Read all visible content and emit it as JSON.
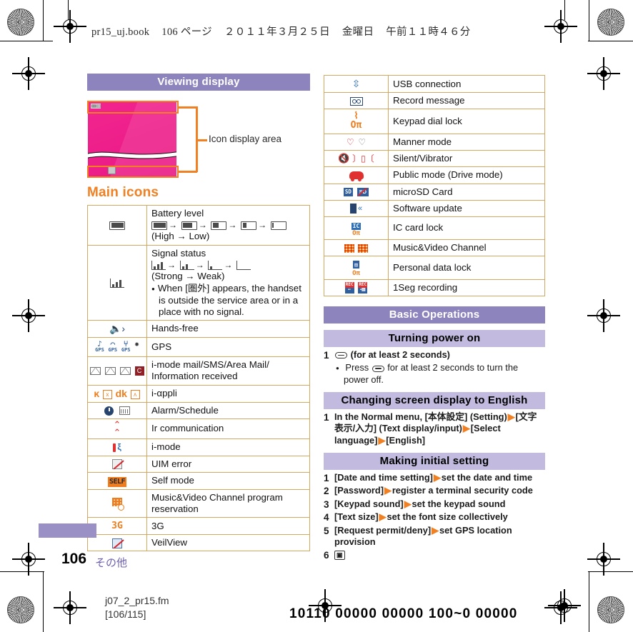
{
  "print_header": {
    "filename": "pr15_uj.book",
    "page": "106 ページ",
    "date": "２０１１年３月２５日",
    "weekday": "金曜日",
    "time": "午前１１時４６分"
  },
  "left_column": {
    "section_title": "Viewing display",
    "figure": {
      "callout_label": "Icon display area"
    },
    "subheading": "Main icons",
    "table_rows": [
      {
        "icon": "battery-level-icon",
        "title": "Battery level",
        "sequence": "(High → Low)"
      },
      {
        "icon": "signal-status-icon",
        "title": "Signal status",
        "sequence": "(Strong → Weak)",
        "note": "When [圏外] appears, the handset is outside the service area or in a place with no signal."
      },
      {
        "icon": "hands-free-icon",
        "title": "Hands-free"
      },
      {
        "icon": "gps-icon",
        "title": "GPS"
      },
      {
        "icon": "mail-received-icon",
        "title": "i-mode mail/SMS/Area Mail/",
        "title2": "Information received"
      },
      {
        "icon": "i-appli-icon",
        "title": "i-αppli"
      },
      {
        "icon": "alarm-schedule-icon",
        "title": "Alarm/Schedule"
      },
      {
        "icon": "ir-communication-icon",
        "title": "Ir communication"
      },
      {
        "icon": "i-mode-icon",
        "title": "i-mode"
      },
      {
        "icon": "uim-error-icon",
        "title": "UIM error"
      },
      {
        "icon": "self-mode-icon",
        "title": "Self mode"
      },
      {
        "icon": "music-video-reservation-icon",
        "title": "Music&Video Channel program",
        "title2": "reservation"
      },
      {
        "icon": "3g-icon",
        "title": "3G"
      },
      {
        "icon": "veilview-icon",
        "title": "VeilView"
      }
    ]
  },
  "right_column": {
    "table_rows": [
      {
        "icon": "usb-connection-icon",
        "title": "USB connection"
      },
      {
        "icon": "record-message-icon",
        "title": "Record message"
      },
      {
        "icon": "keypad-dial-lock-icon",
        "title": "Keypad dial lock"
      },
      {
        "icon": "manner-mode-icon",
        "title": "Manner mode"
      },
      {
        "icon": "silent-vibrator-icon",
        "title": "Silent/Vibrator"
      },
      {
        "icon": "public-mode-icon",
        "title": "Public mode (Drive mode)"
      },
      {
        "icon": "microsd-card-icon",
        "title": "microSD Card"
      },
      {
        "icon": "software-update-icon",
        "title": "Software update"
      },
      {
        "icon": "ic-card-lock-icon",
        "title": "IC card lock"
      },
      {
        "icon": "music-video-channel-icon",
        "title": "Music&Video Channel"
      },
      {
        "icon": "personal-data-lock-icon",
        "title": "Personal data lock"
      },
      {
        "icon": "1seg-recording-icon",
        "title": "1Seg recording"
      }
    ],
    "basic_operations_title": "Basic Operations",
    "sections": [
      {
        "heading": "Turning power on",
        "steps": [
          {
            "num": "1",
            "text_before_key": "",
            "text_after_key": "(for at least 2 seconds)"
          }
        ],
        "substep": "Press  for at least 2 seconds to turn the power off.",
        "substep_before": "Press",
        "substep_after": "for at least 2 seconds to turn the power off."
      },
      {
        "heading": "Changing screen display to English",
        "steps": [
          {
            "num": "1",
            "parts": [
              "In the Normal menu, [本体設定] (Setting)",
              "[文字表示/入力] (Text display/input)",
              "[Select language]",
              "[English]"
            ]
          }
        ]
      },
      {
        "heading": "Making initial setting",
        "steps": [
          {
            "num": "1",
            "parts": [
              "[Date and time setting]",
              "set the date and time"
            ]
          },
          {
            "num": "2",
            "parts": [
              "[Password]",
              "register a terminal security code"
            ]
          },
          {
            "num": "3",
            "parts": [
              "[Keypad sound]",
              "set the keypad sound"
            ]
          },
          {
            "num": "4",
            "parts": [
              "[Text size]",
              "set the font size collectively"
            ]
          },
          {
            "num": "5",
            "parts": [
              "[Request permit/deny]",
              "set GPS location provision"
            ]
          },
          {
            "num": "6",
            "parts": [
              ""
            ],
            "key": "camera-key"
          }
        ]
      }
    ]
  },
  "footer": {
    "page_number": "106",
    "chapter": "その他",
    "file_name": "j07_2_pr15.fm",
    "file_page": "[106/115]",
    "barcode": "10110 00000 00000 100~0 00000"
  },
  "colors": {
    "heading_dark": "#8e84bd",
    "heading_light": "#c2bbdf",
    "accent_orange": "#f08022",
    "table_border": "#d4a860",
    "screen_pink": "#ee1f8a",
    "chapter_purple": "#6d5fae"
  }
}
